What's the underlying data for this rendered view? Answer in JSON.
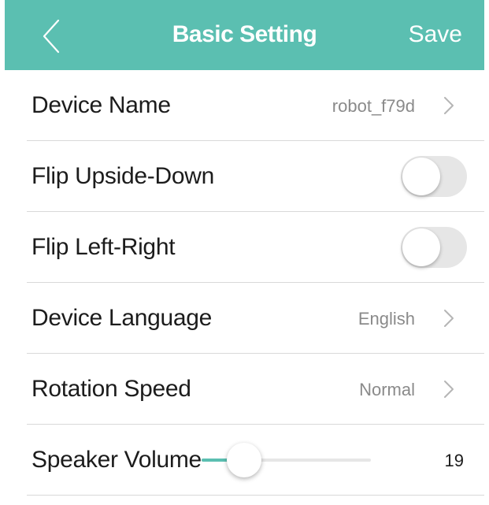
{
  "header": {
    "title": "Basic Setting",
    "save_label": "Save",
    "background_color": "#5bbfb1",
    "back_icon": "chevron-left-icon"
  },
  "settings": {
    "device_name": {
      "label": "Device Name",
      "value": "robot_f79d"
    },
    "flip_upside_down": {
      "label": "Flip Upside-Down",
      "enabled": false
    },
    "flip_left_right": {
      "label": "Flip Left-Right",
      "enabled": false
    },
    "device_language": {
      "label": "Device Language",
      "value": "English"
    },
    "rotation_speed": {
      "label": "Rotation Speed",
      "value": "Normal"
    },
    "speaker_volume": {
      "label": "Speaker Volume",
      "value": "19",
      "level_fraction": 0.25
    }
  },
  "colors": {
    "accent": "#5bbfb1",
    "toggle_off": "#e6e6e6",
    "divider": "#d9d9d9"
  }
}
